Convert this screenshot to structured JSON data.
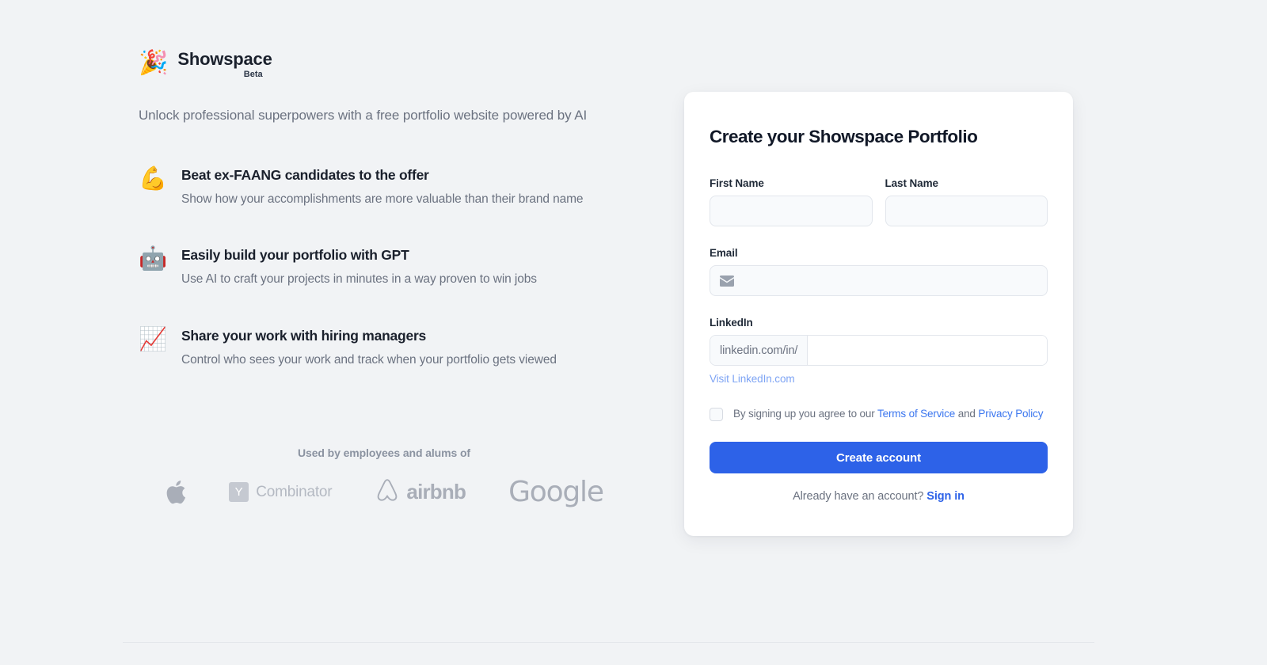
{
  "brand": {
    "emoji": "🎉",
    "emoji_name": "party-popper",
    "name": "Showspace",
    "badge": "Beta",
    "tagline": "Unlock professional superpowers with a free portfolio website powered by AI"
  },
  "features": [
    {
      "emoji": "💪",
      "emoji_name": "flexed-biceps",
      "title": "Beat ex-FAANG candidates to the offer",
      "desc": "Show how your accomplishments are more valuable than their brand name"
    },
    {
      "emoji": "🤖",
      "emoji_name": "robot",
      "title": "Easily build your portfolio with GPT",
      "desc": "Use AI to craft your projects in minutes in a way proven to win jobs"
    },
    {
      "emoji": "📈",
      "emoji_name": "chart-increasing",
      "title": "Share your work with hiring managers",
      "desc": "Control who sees your work and track when your portfolio gets viewed"
    }
  ],
  "social_proof": {
    "label": "Used by employees and alums of",
    "logos": [
      {
        "name": "apple",
        "text": ""
      },
      {
        "name": "y-combinator",
        "mark": "Y",
        "text": "Combinator"
      },
      {
        "name": "airbnb",
        "text": "airbnb"
      },
      {
        "name": "google",
        "text": "Google"
      }
    ]
  },
  "signup": {
    "title": "Create your Showspace Portfolio",
    "first_name": {
      "label": "First Name",
      "value": "",
      "placeholder": ""
    },
    "last_name": {
      "label": "Last Name",
      "value": "",
      "placeholder": ""
    },
    "email": {
      "label": "Email",
      "value": "",
      "placeholder": "",
      "icon": "envelope-icon"
    },
    "linkedin": {
      "label": "LinkedIn",
      "prefix": "linkedin.com/in/",
      "value": "",
      "placeholder": "",
      "helper_link": "Visit LinkedIn.com"
    },
    "terms": {
      "checked": false,
      "text_before": "By signing up you agree to our ",
      "terms_link": "Terms of Service",
      "text_middle": " and ",
      "privacy_link": "Privacy Policy"
    },
    "submit_label": "Create account",
    "signin_prompt": "Already have an account? ",
    "signin_link": "Sign in"
  },
  "colors": {
    "page_background": "#f1f3f5",
    "card_background": "#ffffff",
    "primary_blue": "#2d62e8",
    "link_blue": "#3b76ef",
    "helper_link_blue": "#7ea4f4",
    "heading": "#1a202c",
    "body_text": "#6b7280",
    "logo_gray": "#a9aeb8",
    "input_background": "#f8fafc",
    "input_border": "#e2e6ec",
    "divider": "#e4e7eb"
  }
}
